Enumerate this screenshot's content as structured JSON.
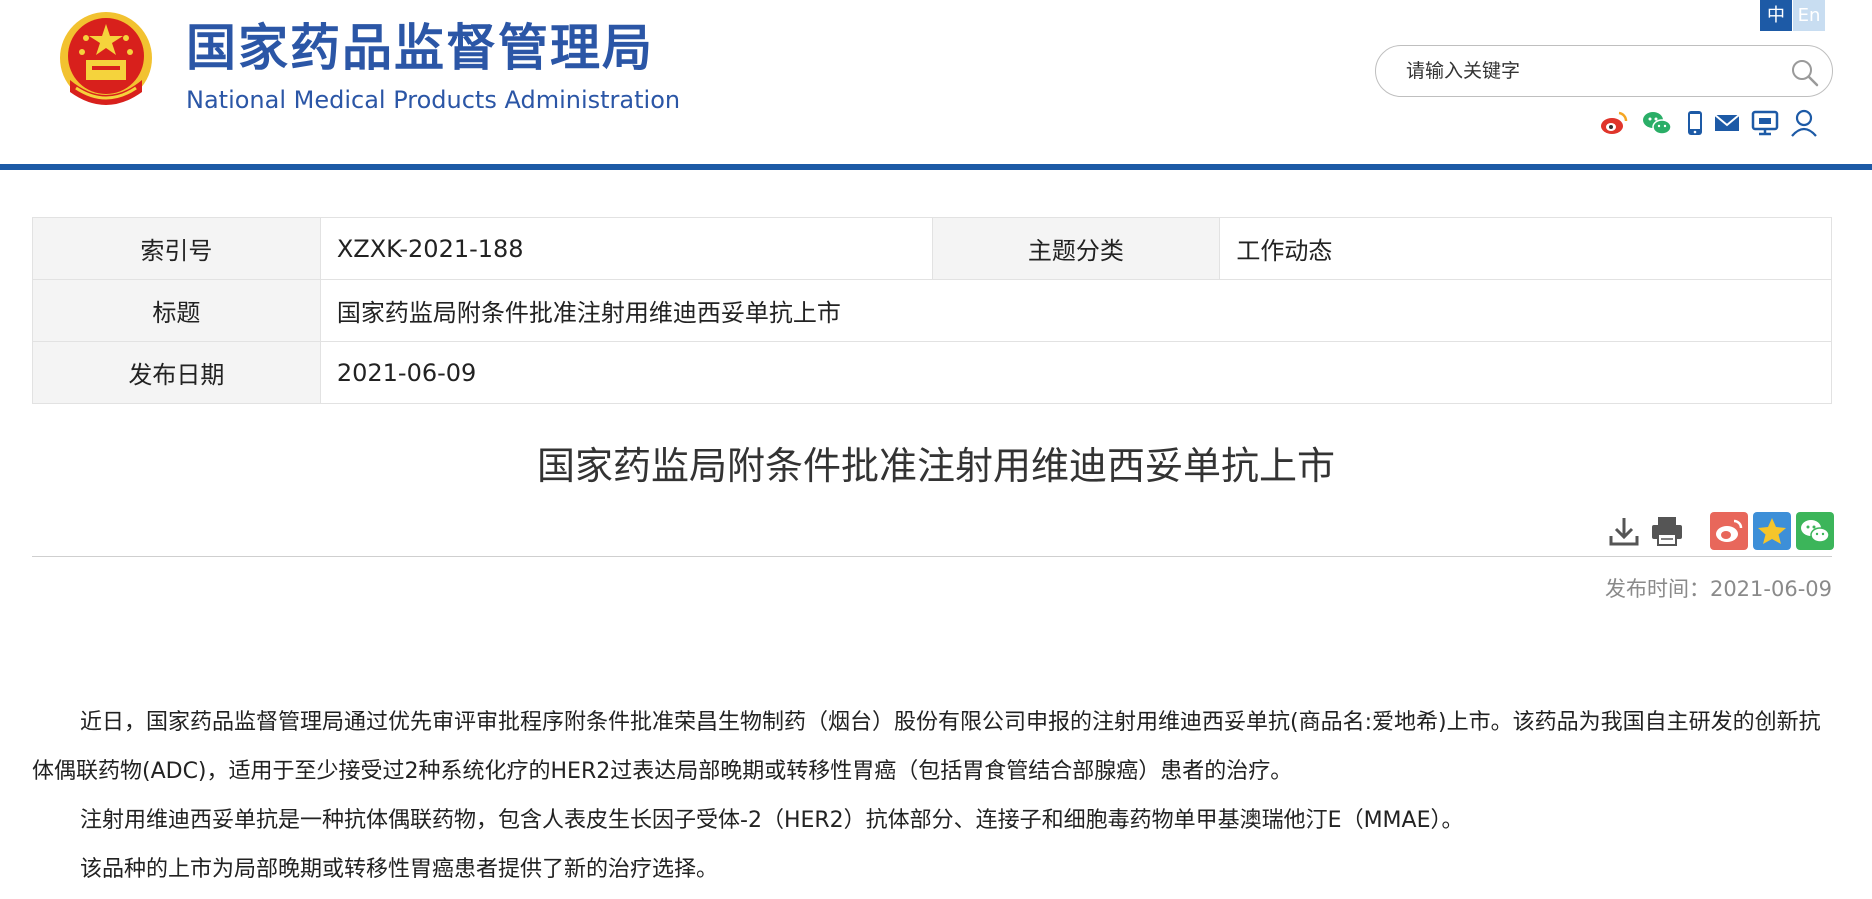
{
  "header": {
    "title_cn": "国家药品监督管理局",
    "title_en": "National Medical Products Administration",
    "lang_cn": "中",
    "lang_en": "En",
    "search_placeholder": "请输入关键字",
    "colors": {
      "brand_blue": "#2b56a6",
      "bar_blue": "#1d5aa6"
    },
    "icons": [
      "weibo-icon",
      "wechat-icon",
      "mobile-icon",
      "mail-icon",
      "monitor-icon",
      "user-icon"
    ]
  },
  "info": {
    "index_label": "索引号",
    "index_value": "XZXK-2021-188",
    "category_label": "主题分类",
    "category_value": "工作动态",
    "title_label": "标题",
    "title_value": "国家药监局附条件批准注射用维迪西妥单抗上市",
    "date_label": "发布日期",
    "date_value": "2021-06-09"
  },
  "article": {
    "title": "国家药监局附条件批准注射用维迪西妥单抗上市",
    "pubtime": "发布时间：2021-06-09",
    "tools": [
      "download-icon",
      "print-icon",
      "share-weibo-icon",
      "favorite-star-icon",
      "share-wechat-icon"
    ],
    "paragraphs": [
      "近日，国家药品监督管理局通过优先审评审批程序附条件批准荣昌生物制药（烟台）股份有限公司申报的注射用维迪西妥单抗(商品名:爱地希)上市。该药品为我国自主研发的创新抗体偶联药物(ADC)，适用于至少接受过2种系统化疗的HER2过表达局部晚期或转移性胃癌（包括胃食管结合部腺癌）患者的治疗。",
      "注射用维迪西妥单抗是一种抗体偶联药物，包含人表皮生长因子受体-2（HER2）抗体部分、连接子和细胞毒药物单甲基澳瑞他汀E（MMAE）。",
      "该品种的上市为局部晚期或转移性胃癌患者提供了新的治疗选择。"
    ]
  }
}
